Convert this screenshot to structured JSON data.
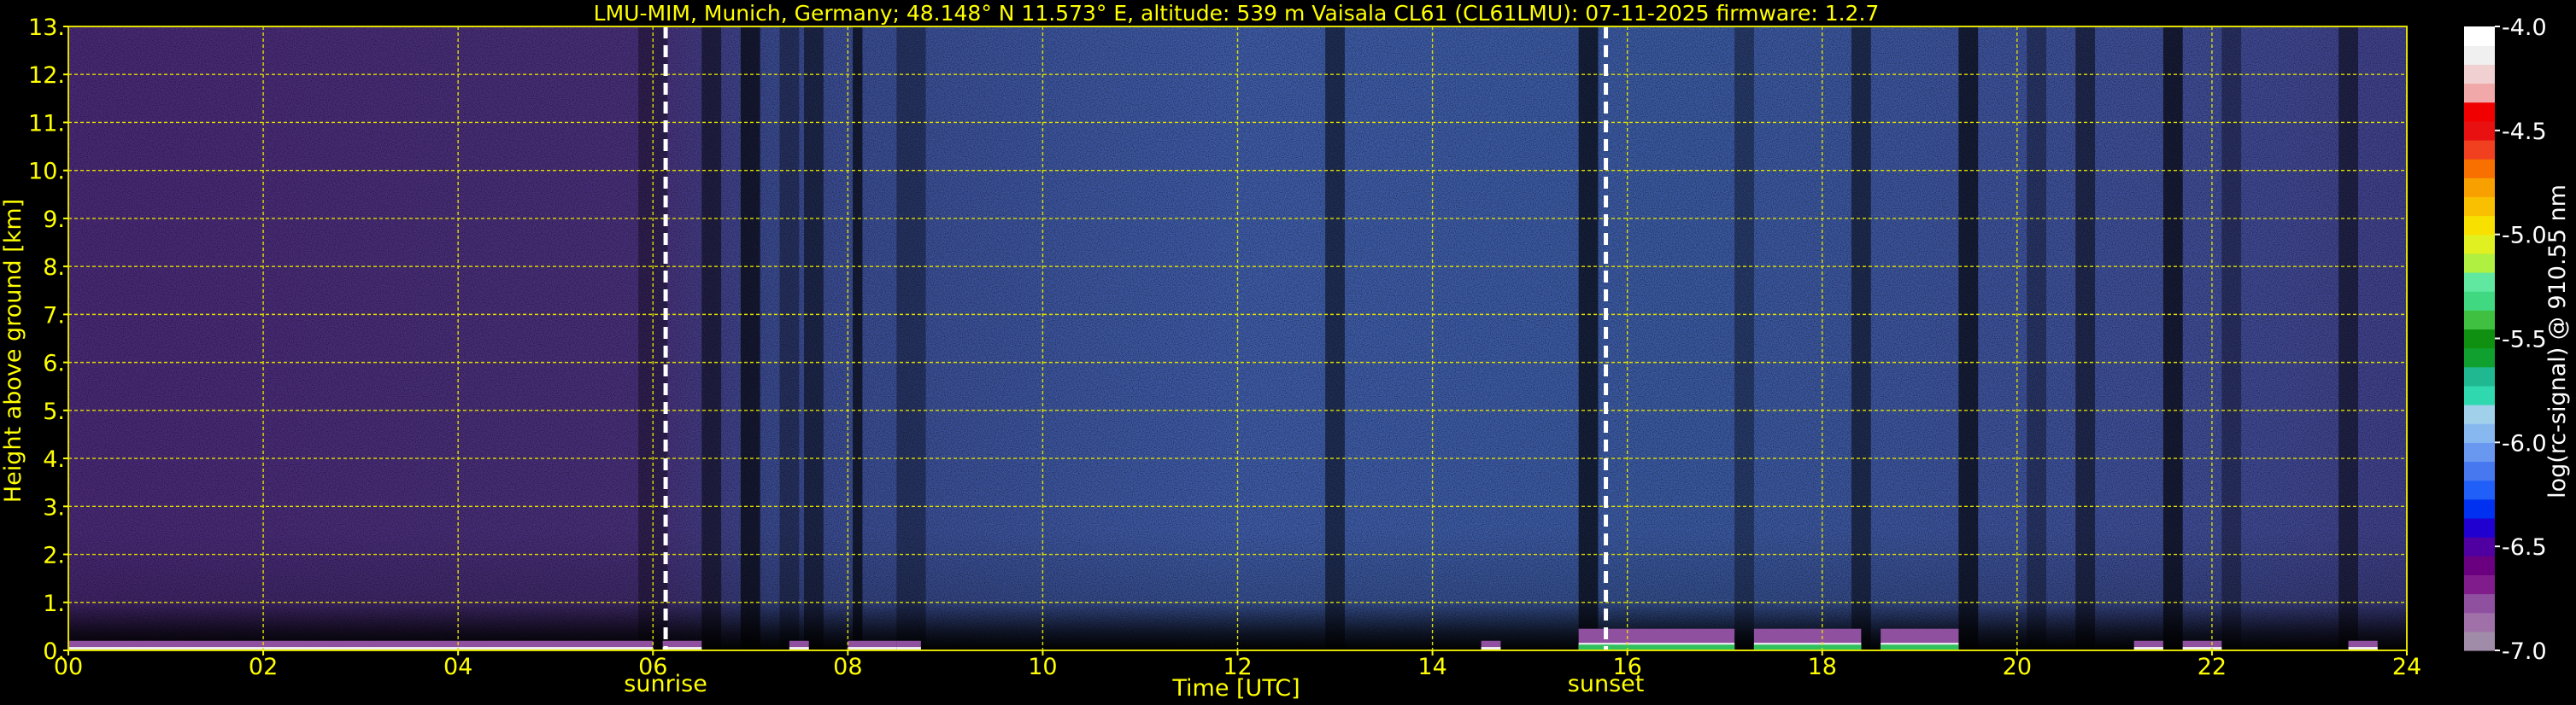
{
  "header": {
    "title": "LMU-MIM, Munich, Germany; 48.148° N 11.573° E, altitude: 539 m    Vaisala CL61 (CL61LMU): 07-11-2025    firmware: 1.2.7"
  },
  "chart_data": {
    "type": "heatmap",
    "xlabel": "Time [UTC]",
    "ylabel": "Height above ground [km]",
    "x_range": [
      0,
      24
    ],
    "y_range": [
      0,
      13
    ],
    "x_ticks": [
      "00",
      "02",
      "04",
      "06",
      "08",
      "10",
      "12",
      "14",
      "16",
      "18",
      "20",
      "22",
      "24"
    ],
    "y_ticks": [
      "0.",
      "1.",
      "2.",
      "3.",
      "4.",
      "5.",
      "6.",
      "7.",
      "8.",
      "9.",
      "10.",
      "11.",
      "12.",
      "13."
    ],
    "grid": true,
    "annotations": [
      {
        "label": "sunrise",
        "time": 6.13
      },
      {
        "label": "sunset",
        "time": 15.78
      }
    ],
    "colorbar": {
      "label": "log(rc-signal) @ 910.55 nm",
      "ticks": [
        "-4.0",
        "-4.5",
        "-5.0",
        "-5.5",
        "-6.0",
        "-6.5",
        "-7.0"
      ],
      "range": [
        -7.0,
        -4.0
      ],
      "colors": [
        "#a08ca8",
        "#a070a8",
        "#9050a0",
        "#801c8c",
        "#6a0080",
        "#5000a0",
        "#2000d0",
        "#0030f0",
        "#2060f8",
        "#4878f0",
        "#6898f0",
        "#88b8f0",
        "#a0d0ea",
        "#30d8b0",
        "#20b890",
        "#10a030",
        "#109010",
        "#40c040",
        "#40d880",
        "#60e8a0",
        "#b0f040",
        "#e0f020",
        "#f8e000",
        "#f8c000",
        "#f8a000",
        "#f87000",
        "#f04020",
        "#e81010",
        "#f00000",
        "#f0a8a8",
        "#f0d0d0",
        "#f0f0f0",
        "#ffffff"
      ]
    },
    "vertical_bands": [
      [
        5.85,
        6.15
      ],
      [
        6.5,
        6.7
      ],
      [
        6.9,
        7.1
      ],
      [
        7.3,
        7.5
      ],
      [
        7.55,
        7.75
      ],
      [
        8.05,
        8.15
      ],
      [
        8.5,
        8.8
      ],
      [
        12.9,
        13.1
      ],
      [
        15.5,
        15.7
      ],
      [
        17.1,
        17.3
      ],
      [
        18.3,
        18.5
      ],
      [
        19.4,
        19.6
      ],
      [
        20.1,
        20.3
      ],
      [
        20.6,
        20.8
      ],
      [
        21.5,
        21.7
      ],
      [
        22.1,
        22.3
      ],
      [
        23.3,
        23.5
      ]
    ],
    "ground_layer_segments": [
      [
        0.0,
        6.0
      ],
      [
        6.1,
        6.5
      ],
      [
        7.4,
        7.6
      ],
      [
        8.0,
        8.5
      ],
      [
        8.5,
        8.75
      ],
      [
        14.5,
        14.7
      ],
      [
        15.5,
        17.1
      ],
      [
        17.3,
        18.4
      ],
      [
        18.6,
        19.4
      ],
      [
        21.2,
        21.5
      ],
      [
        21.7,
        22.1
      ],
      [
        23.4,
        23.7
      ]
    ]
  }
}
